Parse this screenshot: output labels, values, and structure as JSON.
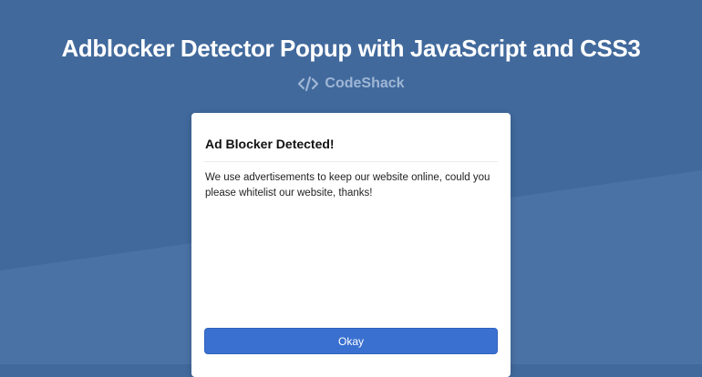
{
  "page": {
    "title": "Adblocker Detector Popup with JavaScript and CSS3",
    "brand": "CodeShack"
  },
  "icons": {
    "brand": "code-brackets-icon"
  },
  "modal": {
    "title": "Ad Blocker Detected!",
    "message": "We use advertisements to keep our website online, could you please whitelist our website, thanks!",
    "button_label": "Okay"
  },
  "colors": {
    "background": "#41699c",
    "background_light": "#4a72a4",
    "title_text": "#ffffff",
    "brand_text": "#9fb6d6",
    "button": "#3a70d0"
  }
}
